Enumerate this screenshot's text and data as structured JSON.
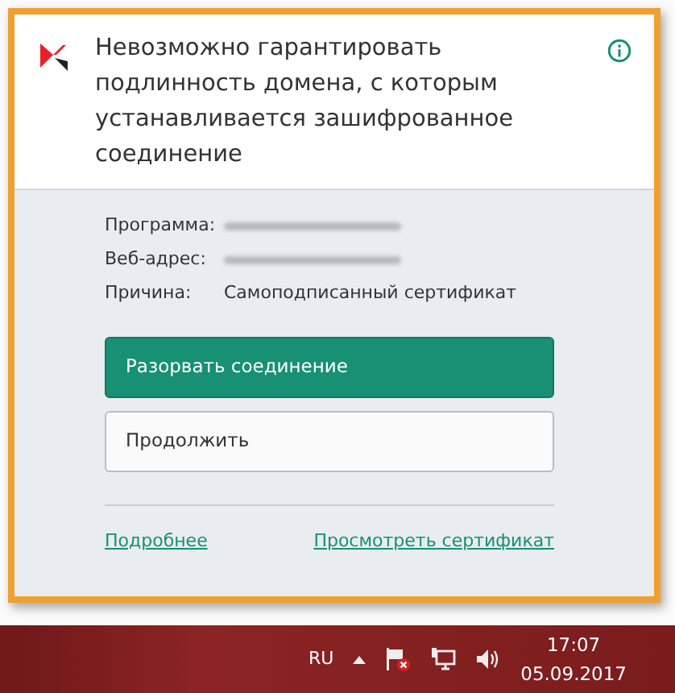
{
  "dialog": {
    "title": "Невозможно гарантировать подлинность домена, с которым устанавливается зашифрованное соединение",
    "details": [
      {
        "label": "Программа:",
        "value_redacted": true
      },
      {
        "label": "Веб-адрес:",
        "value_redacted": true
      },
      {
        "label": "Причина:",
        "value": "Самоподписанный сертификат"
      }
    ],
    "buttons": [
      {
        "label": "Разорвать соединение",
        "kind": "primary"
      },
      {
        "label": "Продолжить",
        "kind": "secondary"
      }
    ],
    "links": [
      "Подробнее",
      "Просмотреть сертификат"
    ]
  },
  "taskbar": {
    "language": "RU",
    "time": "17:07",
    "date": "05.09.2017"
  }
}
